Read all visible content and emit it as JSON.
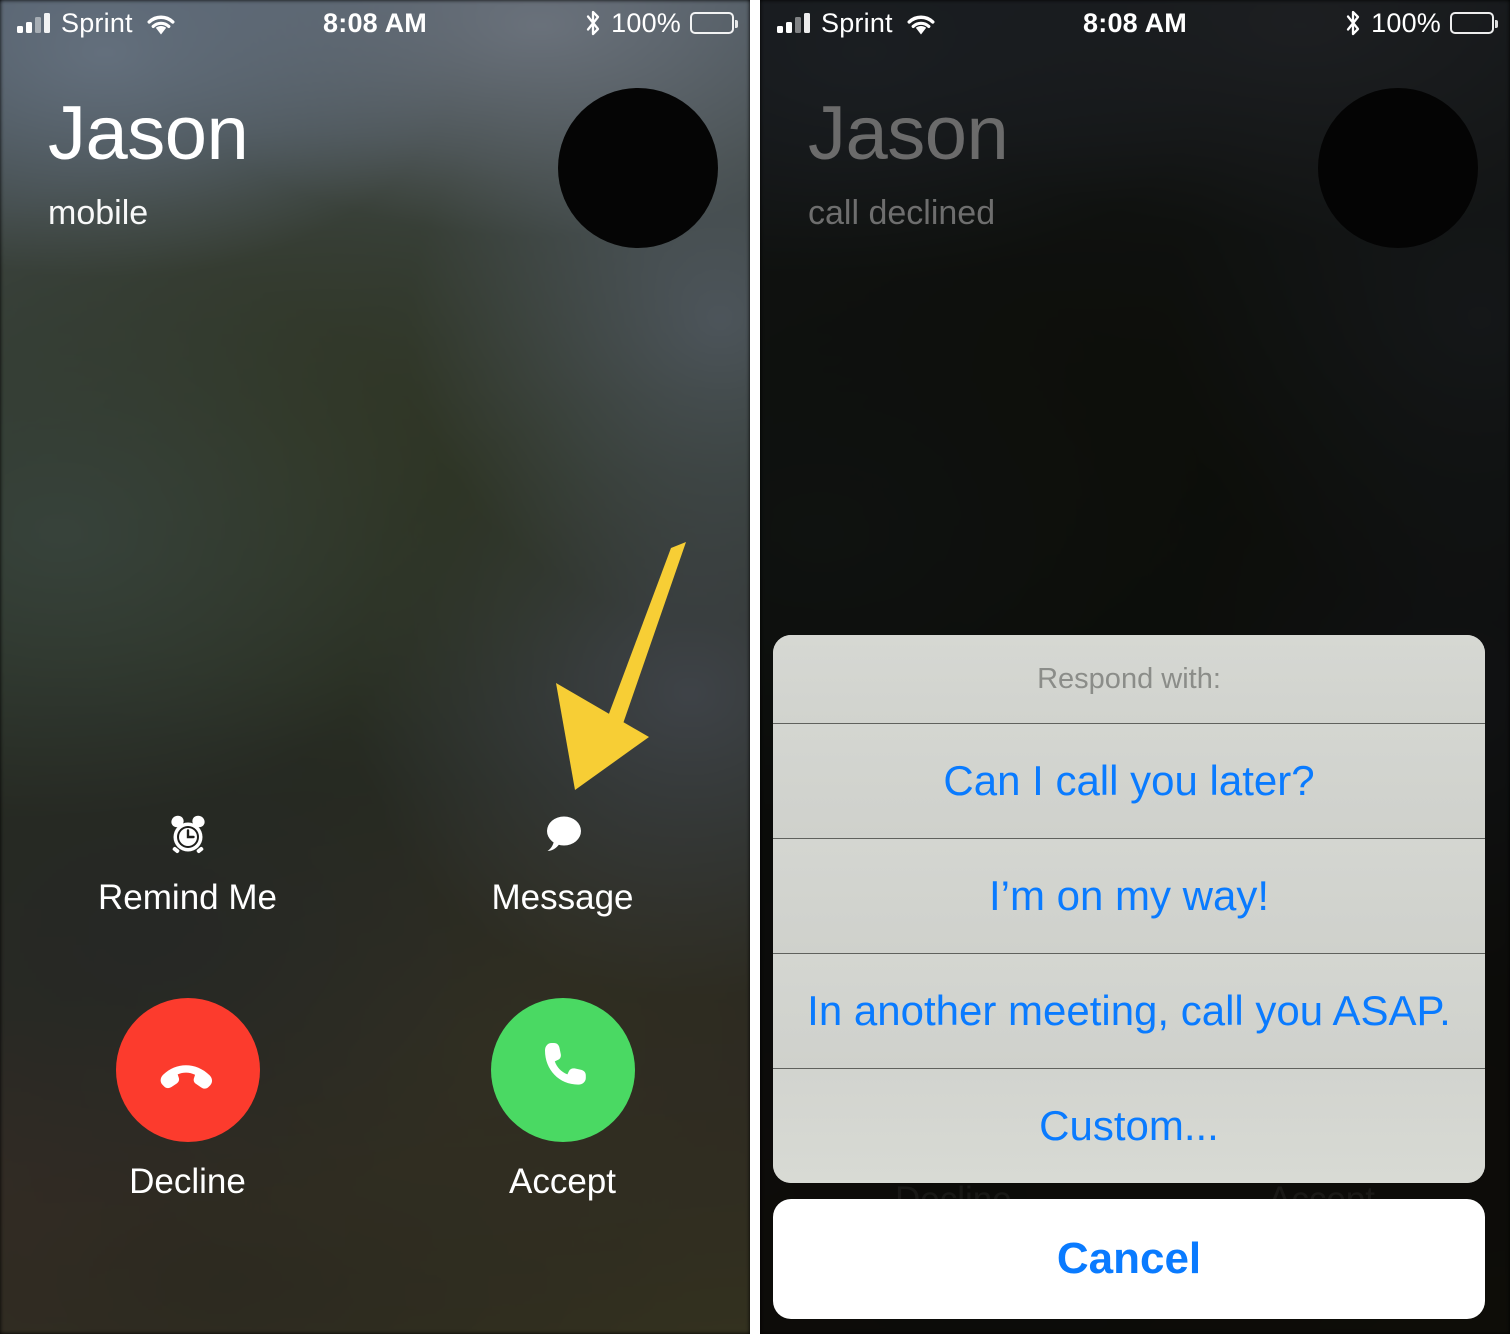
{
  "status_bar": {
    "carrier": "Sprint",
    "time": "8:08 AM",
    "battery_percent": "100%",
    "signal_icon": "cellular-signal-icon",
    "wifi_icon": "wifi-icon",
    "bluetooth_icon": "bluetooth-icon",
    "battery_icon": "battery-full-icon"
  },
  "colors": {
    "decline_red": "#FC3B2D",
    "accept_green": "#4AD963",
    "link_blue": "#0A7BFF",
    "annotation_yellow": "#F7CE35",
    "sheet_gray": "#D2D4CF",
    "cancel_white": "#FFFFFF"
  },
  "left_screen": {
    "caller_name": "Jason",
    "caller_subtitle": "mobile",
    "avatar_icon": "contact-avatar",
    "secondary_actions": [
      {
        "label": "Remind Me",
        "icon": "alarm-clock-icon"
      },
      {
        "label": "Message",
        "icon": "speech-bubble-icon"
      }
    ],
    "primary_actions": [
      {
        "label": "Decline",
        "icon": "phone-down-icon"
      },
      {
        "label": "Accept",
        "icon": "phone-icon"
      }
    ],
    "annotation": {
      "type": "arrow",
      "points_to": "Message",
      "color": "#F7CE35"
    }
  },
  "right_screen": {
    "caller_name": "Jason",
    "caller_subtitle": "call declined",
    "avatar_icon": "contact-avatar",
    "action_sheet": {
      "header": "Respond with:",
      "options": [
        "Can I call you later?",
        "I’m on my way!",
        "In another meeting, call you ASAP.",
        "Custom..."
      ],
      "cancel_label": "Cancel"
    },
    "ghost_labels": {
      "decline": "Decline",
      "accept": "Accept"
    }
  }
}
